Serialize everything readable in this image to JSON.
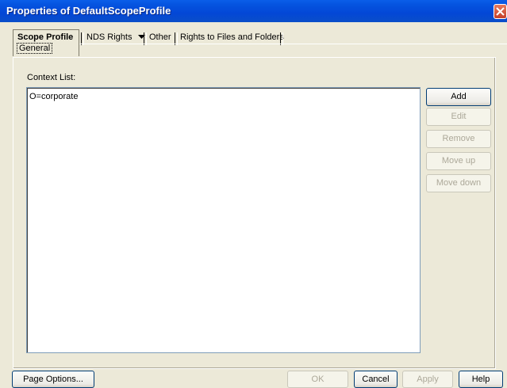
{
  "window": {
    "title": "Properties of DefaultScopeProfile"
  },
  "tabs": {
    "active_main": "Scope Profile",
    "active_sub": "General",
    "items": [
      "NDS Rights",
      "Other",
      "Rights to Files and Folders"
    ]
  },
  "context": {
    "label": "Context List:",
    "items": [
      "O=corporate"
    ]
  },
  "side_buttons": {
    "add": "Add",
    "edit": "Edit",
    "remove": "Remove",
    "move_up": "Move up",
    "move_down": "Move down"
  },
  "footer": {
    "page_options": "Page Options...",
    "ok": "OK",
    "cancel": "Cancel",
    "apply": "Apply",
    "help": "Help"
  },
  "colors": {
    "titlebar": "#0a5ee9",
    "dialog_bg": "#ece9d8",
    "close_button": "#c4402a"
  }
}
